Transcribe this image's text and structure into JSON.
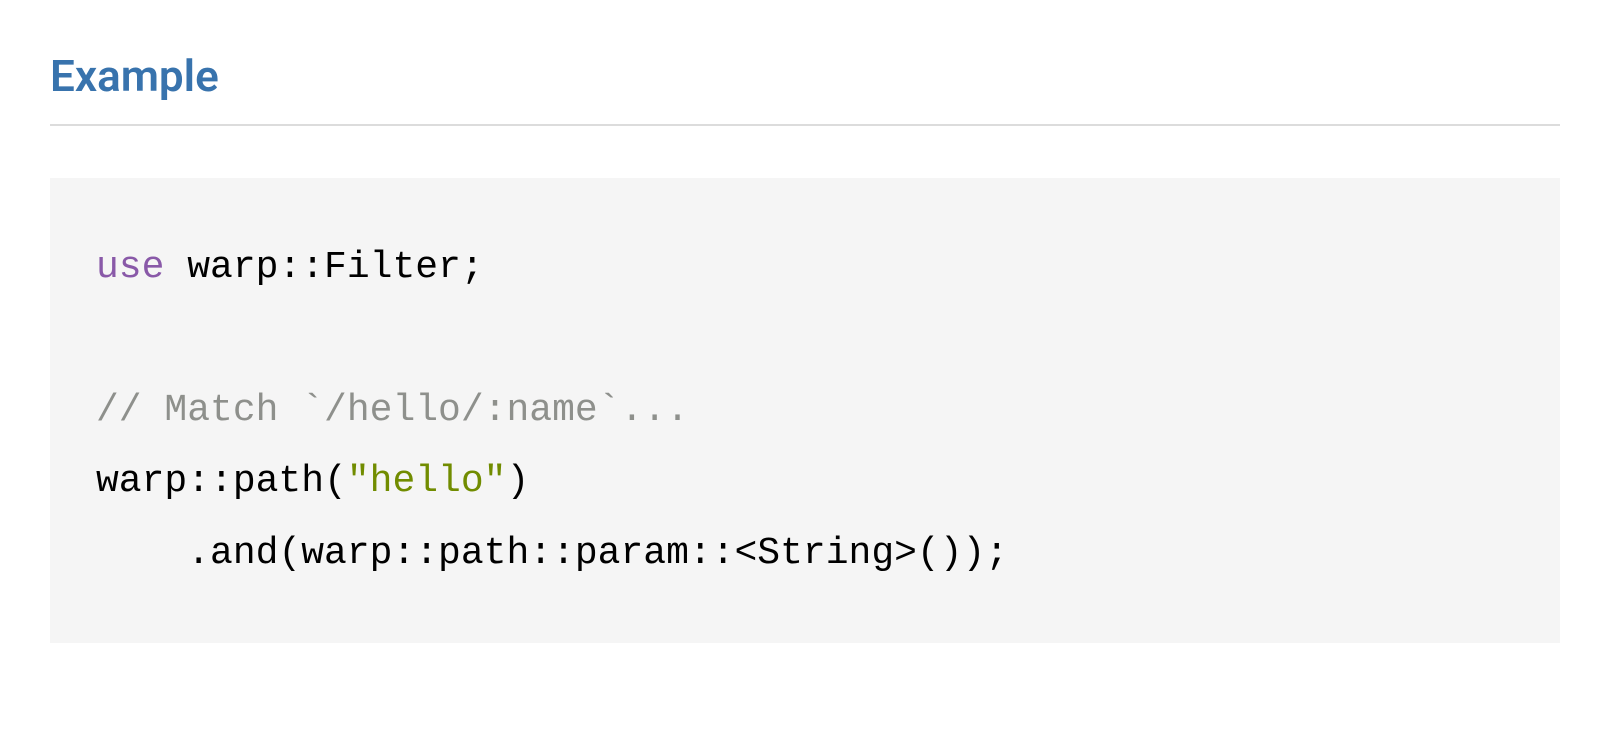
{
  "heading": "Example",
  "code": {
    "line1_kw": "use",
    "line1_rest": " warp::Filter;",
    "blank": "",
    "line2_comment": "// Match `/hello/:name`...",
    "line3_pre": "warp::path(",
    "line3_str": "\"hello\"",
    "line3_post": ")",
    "line4": "    .and(warp::path::param::<String>());"
  }
}
